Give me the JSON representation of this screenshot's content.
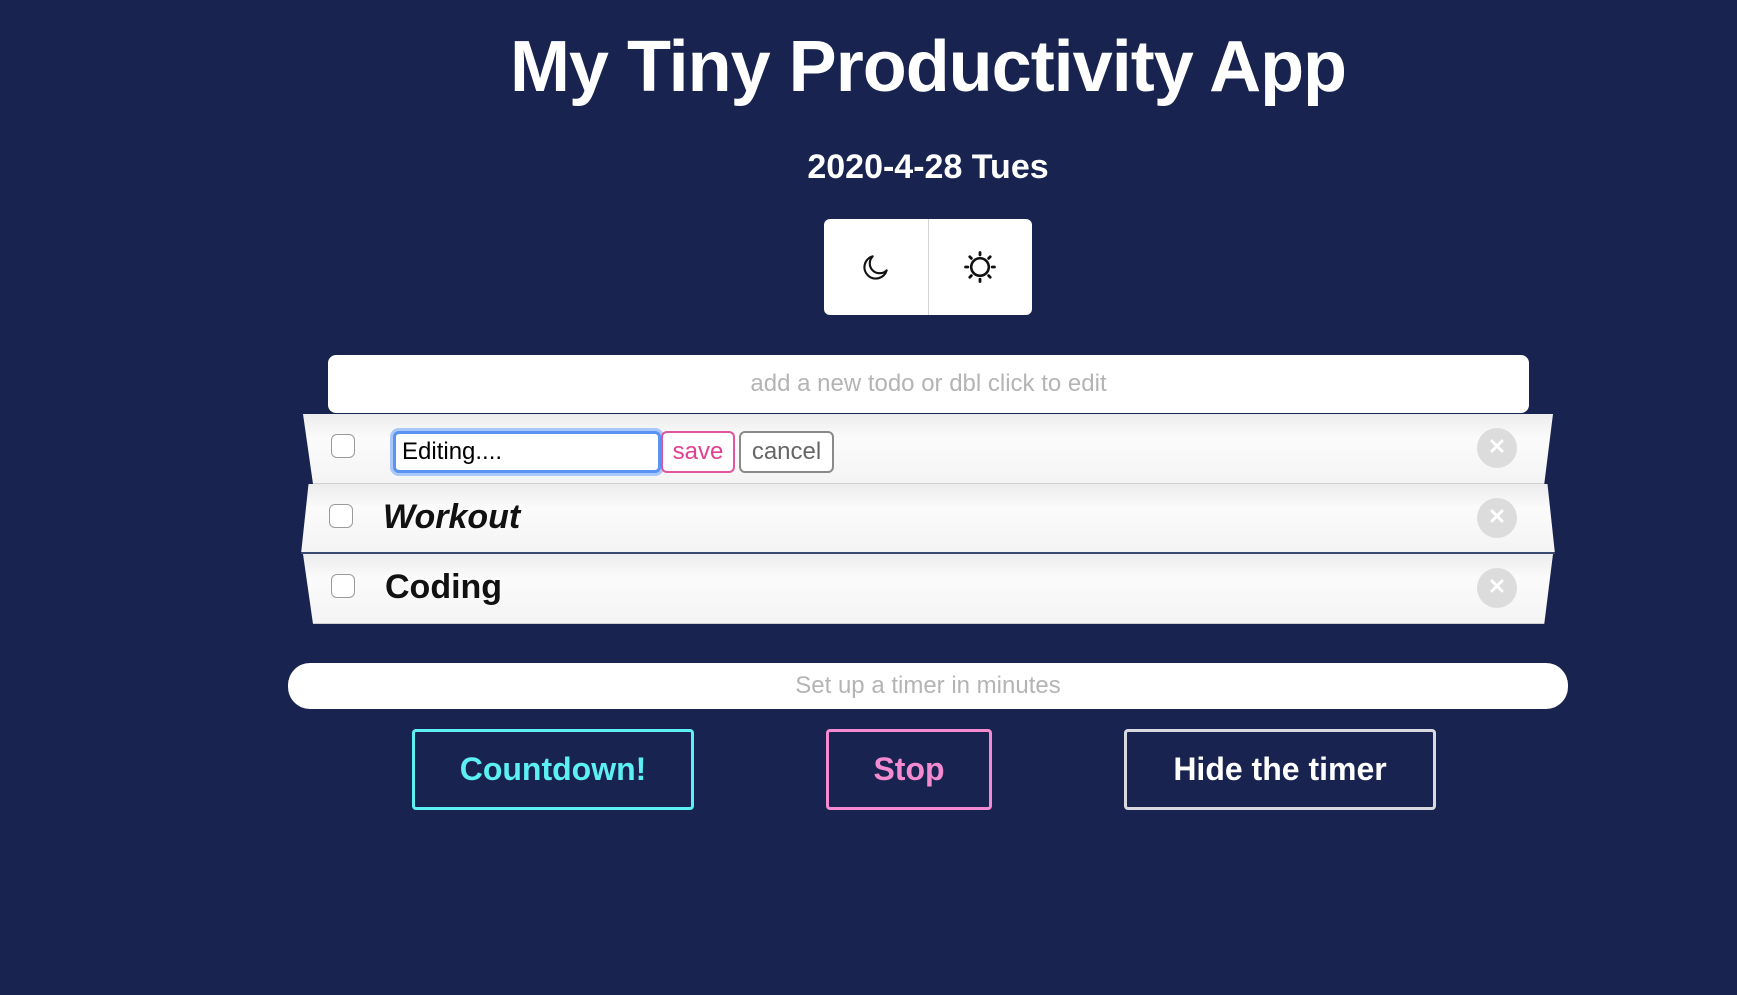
{
  "header": {
    "title": "My Tiny Productivity App",
    "date": "2020-4-28 Tues"
  },
  "theme_toggle": {
    "dark_icon": "moon-icon",
    "light_icon": "sun-icon"
  },
  "new_todo": {
    "placeholder": "add a new todo or dbl click to edit",
    "value": ""
  },
  "todos": [
    {
      "editing": true,
      "edit_value": "Editing....",
      "save_label": "save",
      "cancel_label": "cancel",
      "checked": false,
      "delete_icon": "close-icon"
    },
    {
      "text": "Workout",
      "italic": true,
      "checked": false,
      "delete_icon": "close-icon"
    },
    {
      "text": "Coding",
      "italic": false,
      "checked": false,
      "delete_icon": "close-icon"
    }
  ],
  "timer": {
    "placeholder": "Set up a timer in minutes",
    "value": "",
    "countdown_label": "Countdown!",
    "stop_label": "Stop",
    "hide_label": "Hide the timer"
  },
  "colors": {
    "background": "#18244f",
    "countdown_accent": "#5cf0f4",
    "stop_accent": "#f48bd0",
    "save_accent": "#e0408f",
    "edit_focus": "#5a93f0"
  }
}
